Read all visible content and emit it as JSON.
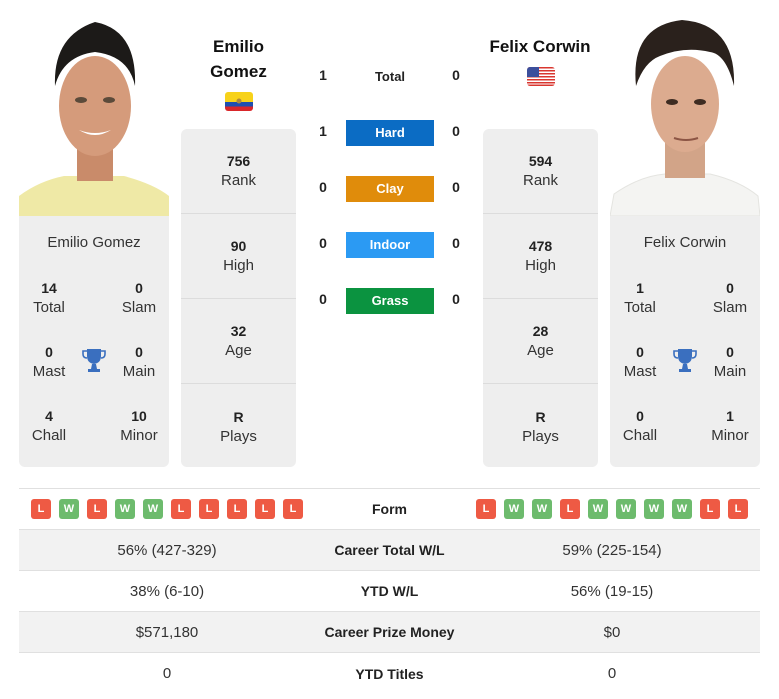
{
  "player1": {
    "name_line1": "Emilio",
    "name_line2": "Gomez",
    "full_name": "Emilio Gomez",
    "country": "Ecuador",
    "flag_icon": "ecuador-flag-icon",
    "rank": "756",
    "rank_label": "Rank",
    "high": "90",
    "high_label": "High",
    "age": "32",
    "age_label": "Age",
    "plays": "R",
    "plays_label": "Plays",
    "titles": {
      "total": "14",
      "total_label": "Total",
      "slam": "0",
      "slam_label": "Slam",
      "mast": "0",
      "mast_label": "Mast",
      "main": "0",
      "main_label": "Main",
      "chall": "4",
      "chall_label": "Chall",
      "minor": "10",
      "minor_label": "Minor"
    },
    "form": [
      "L",
      "W",
      "L",
      "W",
      "W",
      "L",
      "L",
      "L",
      "L",
      "L"
    ],
    "career_wl": "56% (427-329)",
    "ytd_wl": "38% (6-10)",
    "prize_money": "$571,180",
    "ytd_titles": "0"
  },
  "player2": {
    "name": "Felix Corwin",
    "full_name": "Felix Corwin",
    "country": "USA",
    "flag_icon": "usa-flag-icon",
    "rank": "594",
    "rank_label": "Rank",
    "high": "478",
    "high_label": "High",
    "age": "28",
    "age_label": "Age",
    "plays": "R",
    "plays_label": "Plays",
    "titles": {
      "total": "1",
      "total_label": "Total",
      "slam": "0",
      "slam_label": "Slam",
      "mast": "0",
      "mast_label": "Mast",
      "main": "0",
      "main_label": "Main",
      "chall": "0",
      "chall_label": "Chall",
      "minor": "1",
      "minor_label": "Minor"
    },
    "form": [
      "L",
      "W",
      "W",
      "L",
      "W",
      "W",
      "W",
      "W",
      "L",
      "L"
    ],
    "career_wl": "59% (225-154)",
    "ytd_wl": "56% (19-15)",
    "prize_money": "$0",
    "ytd_titles": "0"
  },
  "h2h": {
    "total": {
      "label": "Total",
      "p1": "1",
      "p2": "0"
    },
    "surfaces": [
      {
        "label": "Hard",
        "p1": "1",
        "p2": "0",
        "color": "#0b6cc4"
      },
      {
        "label": "Clay",
        "p1": "0",
        "p2": "0",
        "color": "#e08c0b"
      },
      {
        "label": "Indoor",
        "p1": "0",
        "p2": "0",
        "color": "#2b9af3"
      },
      {
        "label": "Grass",
        "p1": "0",
        "p2": "0",
        "color": "#0b9340"
      }
    ]
  },
  "table": {
    "form_label": "Form",
    "career_label": "Career Total W/L",
    "ytd_label": "YTD W/L",
    "prize_label": "Career Prize Money",
    "titles_label": "YTD Titles"
  },
  "colors": {
    "loss": "#ee5a44",
    "win": "#6dbb6d",
    "trophy": "#3a6fbf"
  }
}
